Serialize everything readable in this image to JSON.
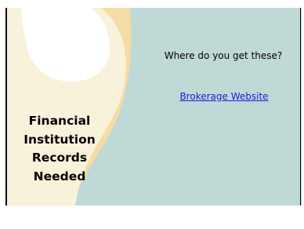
{
  "slide": {
    "title_lines": [
      "Financial",
      "Institution",
      "Records",
      "Needed"
    ],
    "question": "Where do you get these?",
    "link_label": "Brokerage Website"
  },
  "colors": {
    "background": "#bfd9d7",
    "comma_shape": "#f8f2db",
    "comma_shadow": "#f4dca4",
    "link": "#1a1ad9"
  }
}
